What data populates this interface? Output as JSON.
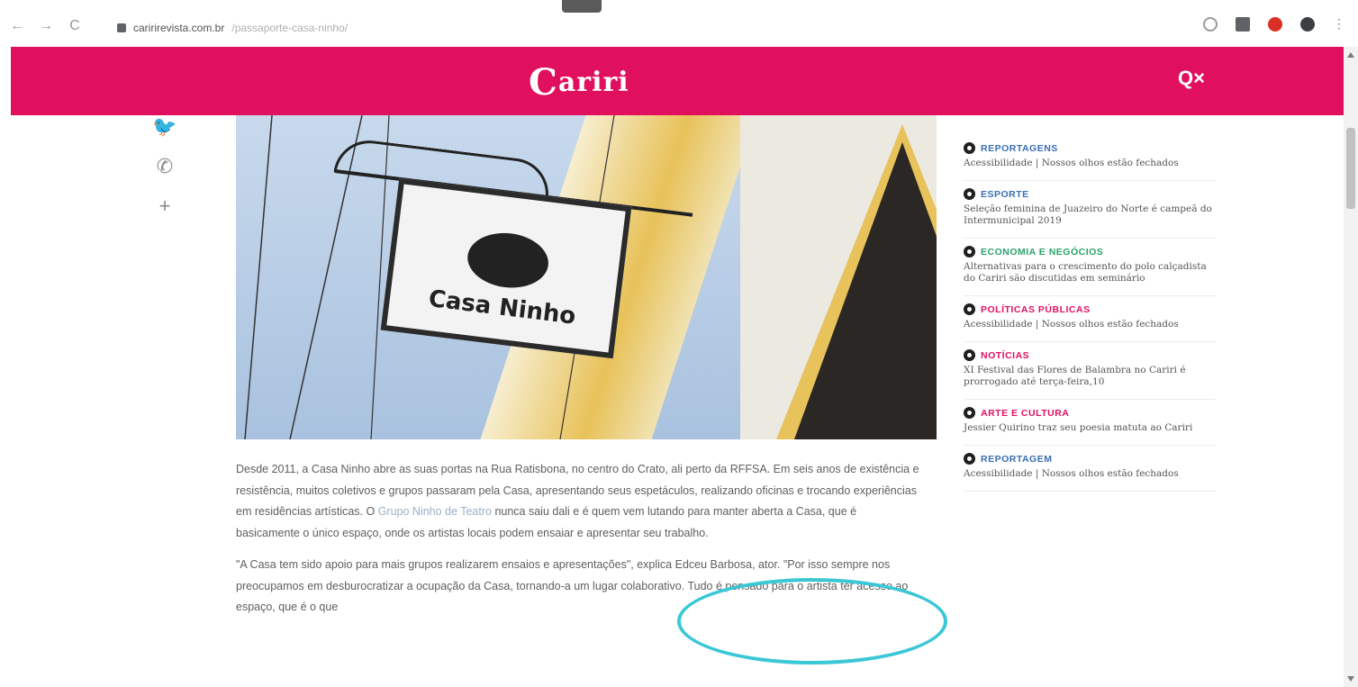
{
  "browser": {
    "url_domain": "caririrevista.com.br",
    "url_path": "/passaporte-casa-ninho/",
    "nav_icons": [
      "back-icon",
      "forward-icon",
      "reload-icon"
    ],
    "extension_icons": [
      "star-icon",
      "extension-icon",
      "adblock-icon",
      "profile-icon",
      "menu-icon"
    ]
  },
  "header": {
    "logo_first": "C",
    "logo_rest": "ariri",
    "actions": "Q×",
    "bg_color": "#e1105f"
  },
  "share": {
    "icons": [
      "twitter-icon",
      "whatsapp-icon",
      "plus-icon"
    ],
    "glyphs": [
      "🐦",
      "✆",
      "+"
    ]
  },
  "hero": {
    "sign_text": "Casa Ninho"
  },
  "article": {
    "p1": "Desde 2011, a Casa Ninho abre as suas portas na Rua Ratisbona, no centro do Crato, ali perto da RFFSA. Em seis anos de existência e resistência, muitos coletivos e grupos passaram pela Casa, apresentando seus espetáculos, realizando oficinas e trocando experiências em residências artísticas. O",
    "p1_link": "Grupo Ninho de Teatro",
    "p1_rest": "nunca saiu dali e é quem vem lutando para manter aberta a Casa, que é basicamente o único espaço, onde os artistas locais podem ensaiar e apresentar seu trabalho.",
    "p2": "\"A Casa tem sido apoio para mais grupos realizarem ensaios e apresentações\", explica Edceu Barbosa, ator. \"Por isso sempre nos preocupamos em desburocratizar a ocupação da Casa, tornando-a um lugar colaborativo. Tudo é pensado para o artista ter acesso ao espaço, que é o que"
  },
  "sidebar": {
    "items": [
      {
        "category": "REPORTAGENS",
        "color": "#3a6fb3",
        "title": "Acessibilidade | Nossos olhos estão fechados"
      },
      {
        "category": "ESPORTE",
        "color": "#3a6fb3",
        "title": "Seleção feminina de Juazeiro do Norte é campeã do Intermunicipal 2019"
      },
      {
        "category": "ECONOMIA E NEGÓCIOS",
        "color": "#2aa36b",
        "title": "Alternativas para o crescimento do polo calçadista do Cariri são discutidas em seminário"
      },
      {
        "category": "POLÍTICAS PÚBLICAS",
        "color": "#e1105f",
        "title": "Acessibilidade | Nossos olhos estão fechados"
      },
      {
        "category": "NOTÍCIAS",
        "color": "#e1105f",
        "title": "XI Festival das Flores de Balambra no Cariri é prorrogado até terça-feira,10"
      },
      {
        "category": "ARTE E CULTURA",
        "color": "#e1105f",
        "title": "Jessier Quirino traz seu poesia matuta ao Cariri"
      },
      {
        "category": "REPORTAGEM",
        "color": "#3a6fb3",
        "title": "Acessibilidade | Nossos olhos estão fechados"
      }
    ]
  }
}
